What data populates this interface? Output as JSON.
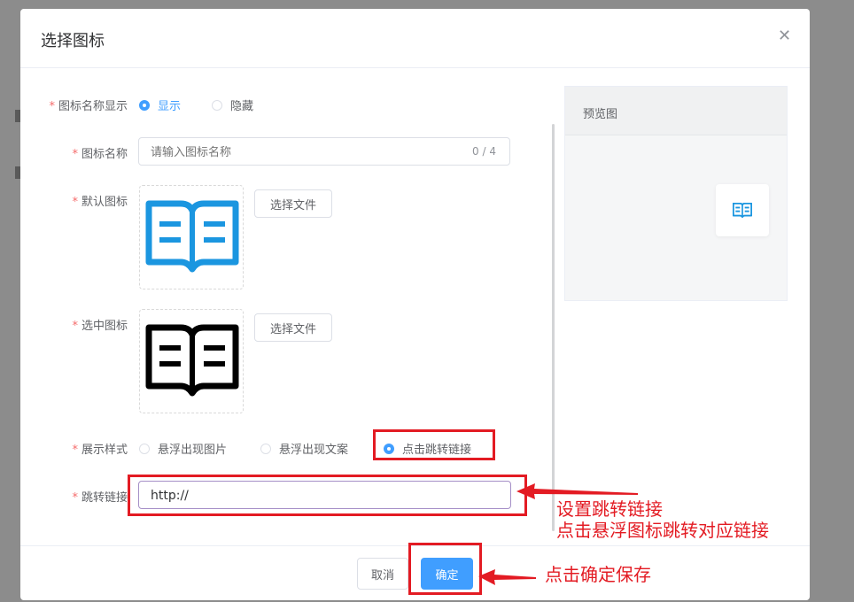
{
  "dialog": {
    "title": "选择图标",
    "close_icon": "close-icon"
  },
  "form": {
    "show_name": {
      "label": "图标名称显示",
      "options": [
        "显示",
        "隐藏"
      ],
      "selected": "显示"
    },
    "icon_name": {
      "label": "图标名称",
      "placeholder": "请输入图标名称",
      "value": "",
      "counter": "0 / 4"
    },
    "default_icon": {
      "label": "默认图标",
      "button": "选择文件",
      "icon": "open-book-icon",
      "icon_color": "#1b96e0"
    },
    "selected_icon": {
      "label": "选中图标",
      "button": "选择文件",
      "icon": "open-book-icon",
      "icon_color": "#000000"
    },
    "display_style": {
      "label": "展示样式",
      "options": [
        "悬浮出现图片",
        "悬浮出现文案",
        "点击跳转链接"
      ],
      "selected": "点击跳转链接"
    },
    "jump_link": {
      "label": "跳转链接",
      "value": "http://"
    }
  },
  "preview": {
    "title": "预览图",
    "icon": "open-book-icon"
  },
  "footer": {
    "cancel": "取消",
    "confirm": "确定"
  },
  "annotations": {
    "link_note_line1": "设置跳转链接",
    "link_note_line2": "点击悬浮图标跳转对应链接",
    "confirm_note": "点击确定保存",
    "color": "#e31b23"
  },
  "colors": {
    "primary": "#409eff",
    "required": "#f56c6c"
  }
}
